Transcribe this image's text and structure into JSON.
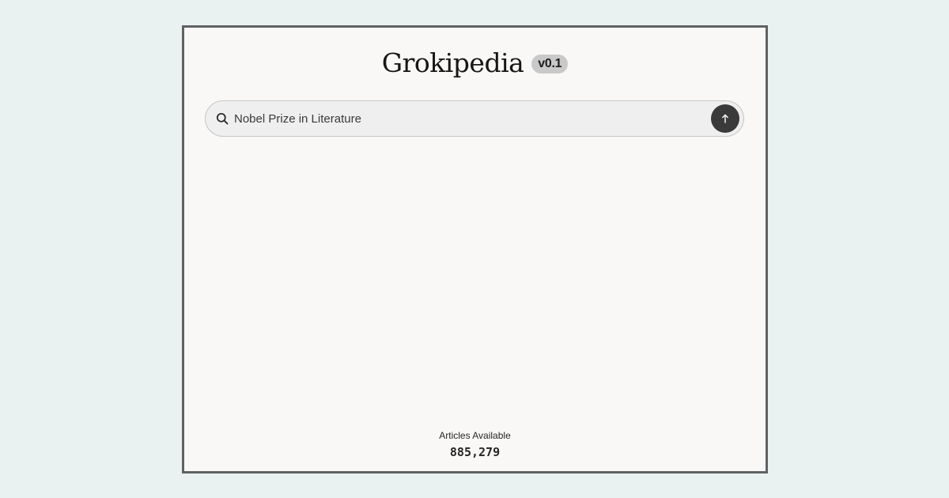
{
  "header": {
    "logo": "Grokipedia",
    "version": "v0.1"
  },
  "search": {
    "value": "Nobel Prize in Literature",
    "icon": "search-icon",
    "submit_icon": "arrow-up-icon"
  },
  "stats": {
    "label": "Articles Available",
    "count": "885,279"
  },
  "colors": {
    "background": "#e9f2f1",
    "frame_border": "#5f6163",
    "page": "#f9f8f6",
    "submit_button": "#3a3a3a",
    "badge": "#c9c9c9"
  }
}
